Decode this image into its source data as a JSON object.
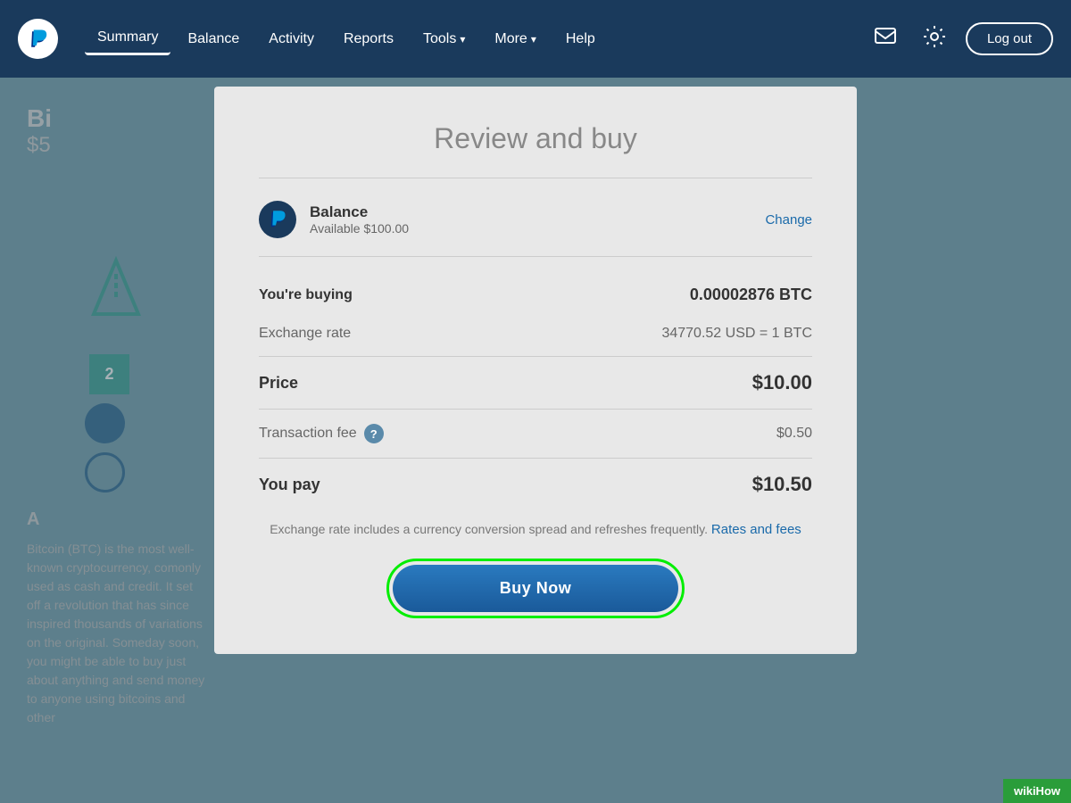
{
  "navbar": {
    "logo_alt": "PayPal logo",
    "nav_items": [
      {
        "label": "Summary",
        "id": "summary",
        "active": true
      },
      {
        "label": "Balance",
        "id": "balance",
        "active": false
      },
      {
        "label": "Activity",
        "id": "activity",
        "active": false
      },
      {
        "label": "Reports",
        "id": "reports",
        "active": false
      },
      {
        "label": "Tools",
        "id": "tools",
        "active": false,
        "has_dropdown": true
      },
      {
        "label": "More",
        "id": "more",
        "active": false,
        "has_dropdown": true
      },
      {
        "label": "Help",
        "id": "help",
        "active": false
      }
    ],
    "logout_label": "Log out"
  },
  "background": {
    "title": "Bi",
    "price": "$5",
    "badge_number": "2",
    "paragraph": "Bitcoin (BTC) is the most well-known cryptocurrency, comonly used as cash and credit. It set off a revolution that has since inspired thousands of variations on the original. Someday soon, you might be able to buy just about anything and send money to anyone using bitcoins and other",
    "section_title": "A"
  },
  "modal": {
    "title": "Review and buy",
    "payment_method": {
      "label": "Balance",
      "available": "Available $100.00",
      "change_label": "Change"
    },
    "you_are_buying_label": "You're buying",
    "you_are_buying_value": "0.00002876 BTC",
    "exchange_rate_label": "Exchange rate",
    "exchange_rate_value": "34770.52 USD = 1 BTC",
    "price_label": "Price",
    "price_value": "$10.00",
    "transaction_fee_label": "Transaction fee",
    "transaction_fee_value": "$0.50",
    "you_pay_label": "You pay",
    "you_pay_value": "$10.50",
    "footer_note": "Exchange rate includes a currency conversion\nspread and refreshes frequently.",
    "rates_link": "Rates and fees",
    "buy_button_label": "Buy Now"
  },
  "wikihow": {
    "label": "wikiHow"
  }
}
